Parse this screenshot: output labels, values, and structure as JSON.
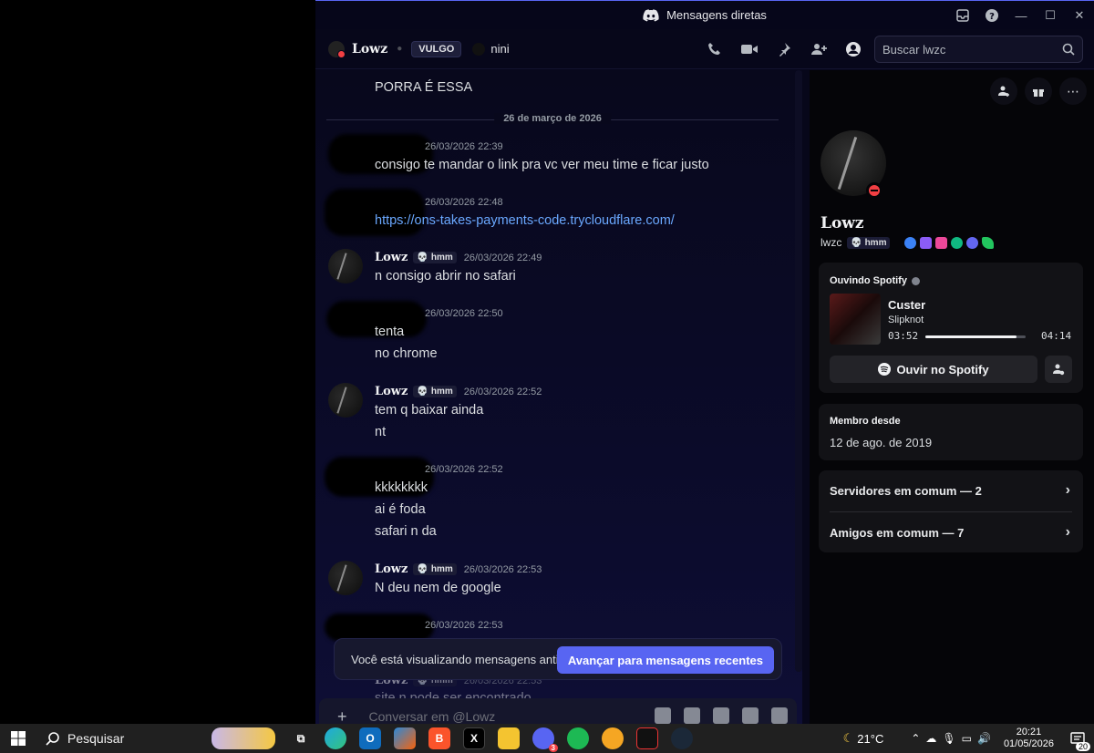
{
  "window": {
    "title": "Mensagens diretas"
  },
  "header": {
    "name": "Lowz",
    "tag": "VULGO",
    "status_text": "nini",
    "search_placeholder": "Buscar lwzc"
  },
  "chat": {
    "top_text": "PORRA É ESSA",
    "date_divider": "26 de março de 2026",
    "messages": [
      {
        "author": "",
        "time": "26/03/2026 22:39",
        "lines": [
          "consigo te mandar o link pra vc ver meu time e ficar justo"
        ]
      },
      {
        "author": "",
        "time": "26/03/2026 22:48",
        "lines": [
          "https://ons-takes-payments-code.trycloudflare.com/"
        ]
      },
      {
        "author": "Lowz",
        "tag": "hmm",
        "time": "26/03/2026 22:49",
        "lines": [
          "n consigo abrir no safari"
        ]
      },
      {
        "author": "",
        "time": "26/03/2026 22:50",
        "lines": [
          "tenta",
          "no chrome"
        ]
      },
      {
        "author": "Lowz",
        "tag": "hmm",
        "time": "26/03/2026 22:52",
        "lines": [
          "tem q baixar ainda",
          "nt"
        ]
      },
      {
        "author": "",
        "time": "26/03/2026 22:52",
        "lines": [
          "kkkkkkkk",
          "ai é foda",
          "safari n da"
        ]
      },
      {
        "author": "Lowz",
        "tag": "hmm",
        "time": "26/03/2026 22:53",
        "lines": [
          "N deu nem de google"
        ]
      },
      {
        "author": "",
        "time": "26/03/2026 22:53",
        "lines": []
      },
      {
        "author": "Lowz",
        "tag": "hmm",
        "time": "26/03/2026 22:53",
        "lines": [
          "site n pode ser encontrado"
        ]
      }
    ],
    "jump_bar": {
      "label": "Você está visualizando mensagens antigas",
      "button": "Avançar para mensagens recentes"
    },
    "composer_placeholder": "Conversar em @Lowz"
  },
  "profile": {
    "display_name": "Lowz",
    "username": "lwzc",
    "tag": "hmm",
    "activity": {
      "title": "Ouvindo Spotify",
      "song": "Custer",
      "artist": "Slipknot",
      "elapsed": "03:52",
      "total": "04:14",
      "progress": 0.913,
      "button": "Ouvir no Spotify"
    },
    "member_since_title": "Membro desde",
    "member_since": "12 de ago. de 2019",
    "mutual_servers": "Servidores em comum — 2",
    "mutual_friends": "Amigos em comum — 7",
    "badge_colors": [
      "#3b82f6",
      "#8b5cf6",
      "#ec4899",
      "#10b981",
      "#6366f1",
      "#22c55e"
    ]
  },
  "taskbar": {
    "search": "Pesquisar",
    "weather": "21°C",
    "time": "20:21",
    "date": "01/05/2026",
    "notifications": "20",
    "discord_badge": "3"
  },
  "colors": {
    "accent": "#5865f2",
    "dnd": "#f23f43",
    "spotify": "#1db954"
  }
}
